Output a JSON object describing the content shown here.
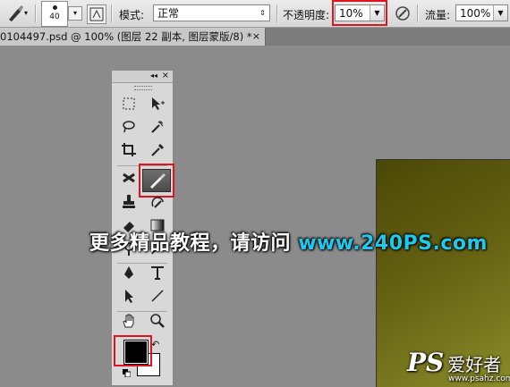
{
  "options_bar": {
    "brush_size": "40",
    "mode_label": "模式:",
    "mode_value": "正常",
    "opacity_label": "不透明度:",
    "opacity_value": "10%",
    "flow_label": "流量:",
    "flow_value": "100%"
  },
  "document_tab": {
    "title": "0104497.psd @ 100% (图层 22 副本, 图层蒙版/8) *",
    "close": "×"
  },
  "toolbox": {
    "collapse": "◂◂",
    "close": "×"
  },
  "overlay": {
    "text": "更多精品教程，请访问",
    "url": "www.240PS.com"
  },
  "watermark": {
    "logo": "PS",
    "chinese": "爱好者",
    "site": "www.psahz.com"
  },
  "colors": {
    "highlight": "#e0141e",
    "url_color": "#1ec9ef",
    "canvas": "#636012"
  }
}
